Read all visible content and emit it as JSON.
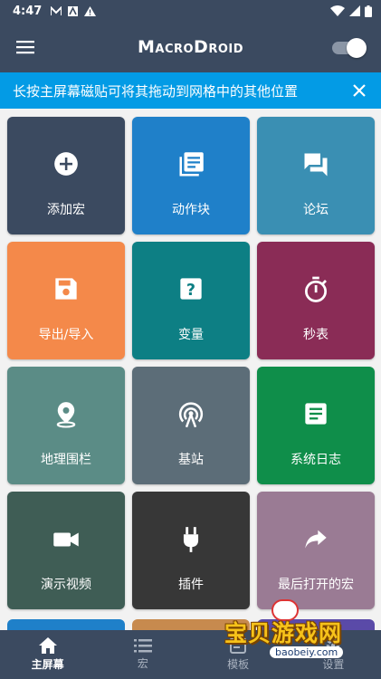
{
  "statusbar": {
    "time": "4:47"
  },
  "appbar": {
    "title": "MacroDroid"
  },
  "banner": {
    "text": "长按主屏幕磁贴可将其拖动到网格中的其他位置"
  },
  "colors": {
    "primary": "#3b4a60",
    "banner": "#039be5"
  },
  "tiles": [
    {
      "label": "添加宏",
      "icon": "add-circle-icon",
      "color": "#3b4a60"
    },
    {
      "label": "动作块",
      "icon": "library-books-icon",
      "color": "#1f80c9"
    },
    {
      "label": "论坛",
      "icon": "forum-icon",
      "color": "#3a8fb3"
    },
    {
      "label": "导出/导入",
      "icon": "save-icon",
      "color": "#f4894a"
    },
    {
      "label": "变量",
      "icon": "help-box-icon",
      "color": "#0d7f84"
    },
    {
      "label": "秒表",
      "icon": "timer-icon",
      "color": "#8a2c56"
    },
    {
      "label": "地理围栏",
      "icon": "location-pin-icon",
      "color": "#5b8c86"
    },
    {
      "label": "基站",
      "icon": "cell-tower-icon",
      "color": "#5c6d78"
    },
    {
      "label": "系统日志",
      "icon": "log-icon",
      "color": "#0f8e4a"
    },
    {
      "label": "演示视频",
      "icon": "video-camera-icon",
      "color": "#3f5d55"
    },
    {
      "label": "插件",
      "icon": "plug-icon",
      "color": "#373737"
    },
    {
      "label": "最后打开的宏",
      "icon": "share-arrow-icon",
      "color": "#9a7b94"
    }
  ],
  "bottom_nav": [
    {
      "label": "主屏幕",
      "icon": "home-icon"
    },
    {
      "label": "宏",
      "icon": "list-icon"
    },
    {
      "label": "模板",
      "icon": "template-icon"
    },
    {
      "label": "设置",
      "icon": "settings-icon"
    }
  ],
  "watermark": {
    "text": "宝贝游戏网",
    "url": "baobeiy.com"
  }
}
